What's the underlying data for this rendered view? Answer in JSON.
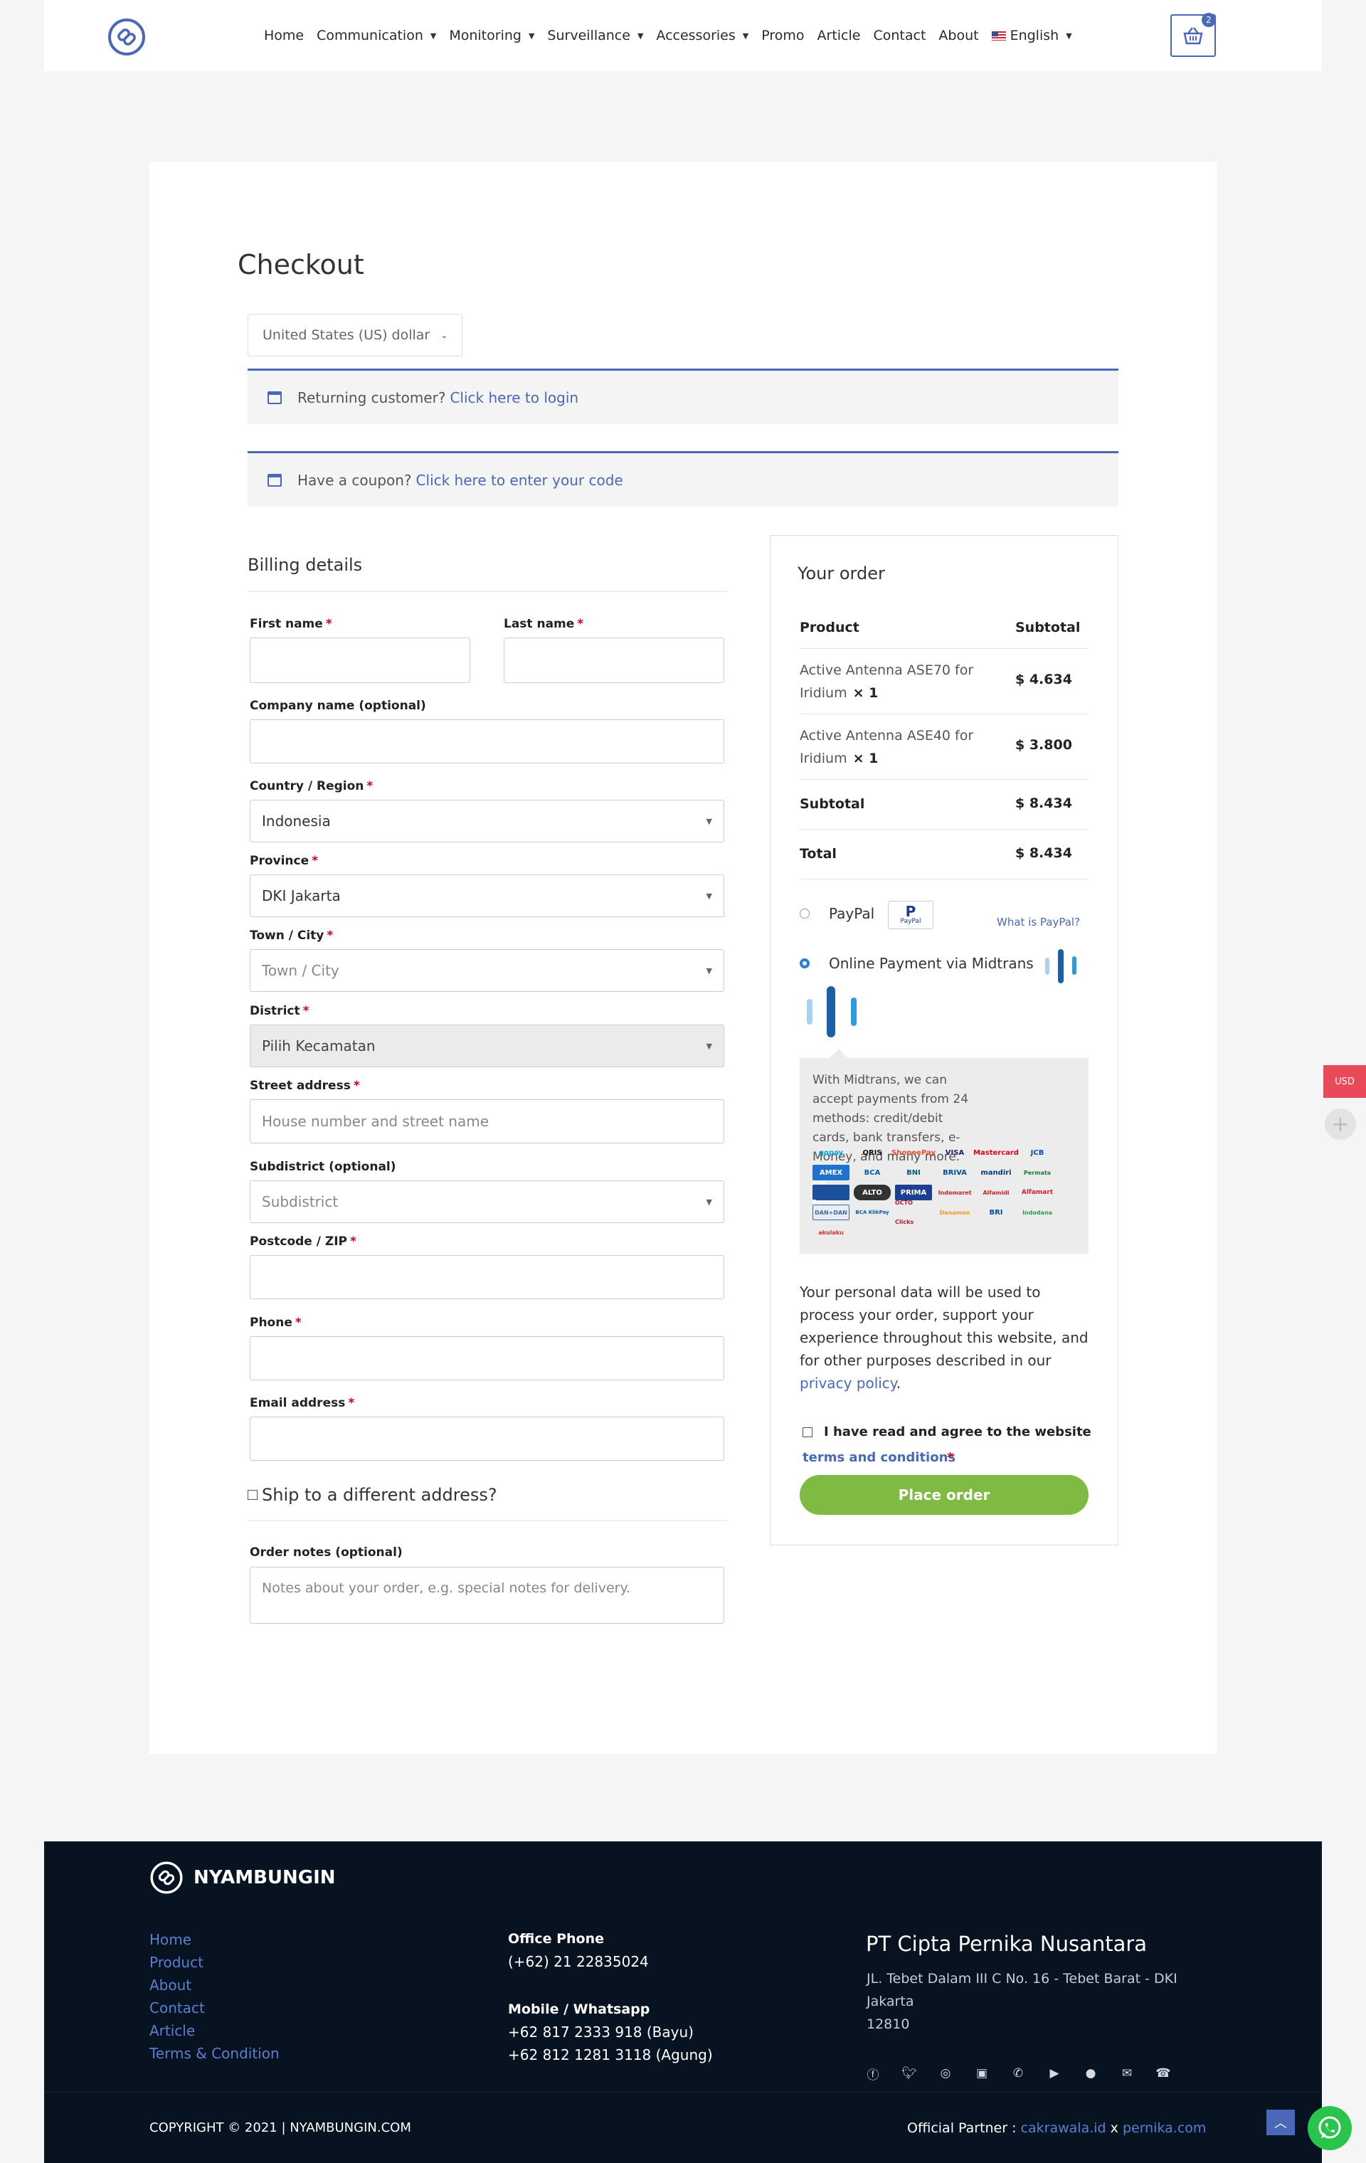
{
  "nav": {
    "items": [
      {
        "label": "Home",
        "dropdown": false
      },
      {
        "label": "Communication",
        "dropdown": true
      },
      {
        "label": "Monitoring",
        "dropdown": true
      },
      {
        "label": "Surveillance",
        "dropdown": true
      },
      {
        "label": "Accessories",
        "dropdown": true
      },
      {
        "label": "Promo",
        "dropdown": false
      },
      {
        "label": "Article",
        "dropdown": false
      },
      {
        "label": "Contact",
        "dropdown": false
      },
      {
        "label": "About",
        "dropdown": false
      }
    ],
    "language": "English",
    "cart_count": "2"
  },
  "checkout": {
    "title": "Checkout",
    "currency": "United States (US) dollar",
    "returning": {
      "text": "Returning customer?",
      "link": "Click here to login"
    },
    "coupon": {
      "text": "Have a coupon?",
      "link": "Click here to enter your code"
    }
  },
  "billing": {
    "title": "Billing details",
    "first_name": "First name",
    "last_name": "Last name",
    "company": "Company name (optional)",
    "country_label": "Country / Region",
    "country_value": "Indonesia",
    "province_label": "Province",
    "province_value": "DKI Jakarta",
    "city_label": "Town / City",
    "city_placeholder": "Town / City",
    "district_label": "District",
    "district_value": "Pilih Kecamatan",
    "street_label": "Street address",
    "street_placeholder": "House number and street name",
    "subdistrict_label": "Subdistrict (optional)",
    "subdistrict_placeholder": "Subdistrict",
    "postcode_label": "Postcode / ZIP",
    "phone_label": "Phone",
    "email_label": "Email address",
    "ship_different": "Ship to a different address?",
    "notes_label": "Order notes (optional)",
    "notes_placeholder": "Notes about your order, e.g. special notes for delivery.",
    "required_mark": "*"
  },
  "order": {
    "title": "Your order",
    "col_product": "Product",
    "col_subtotal": "Subtotal",
    "items": [
      {
        "name": "Active Antenna ASE70 for Iridium",
        "qty": "× 1",
        "price": "$ 4.634"
      },
      {
        "name": "Active Antenna ASE40 for Iridium",
        "qty": "× 1",
        "price": "$ 3.800"
      }
    ],
    "subtotal_label": "Subtotal",
    "subtotal_value": "$ 8.434",
    "total_label": "Total",
    "total_value": "$ 8.434",
    "paypal_label": "PayPal",
    "paypal_badge": "PayPal",
    "paypal_link": "What is PayPal?",
    "midtrans_label": "Online Payment via Midtrans",
    "midtrans_desc": "With Midtrans, we can accept payments from 24 methods: credit/debit cards, bank transfers, e-Money, and many more.",
    "pay_logos": [
      "gopay",
      "QRIS",
      "ShopeePay",
      "VISA",
      "Mastercard",
      "JCB",
      "AMEX",
      "BCA",
      "BNI",
      "BRIVA",
      "mandiri",
      "Permata",
      "ATM Bersama",
      "ALTO",
      "PRIMA",
      "Indomaret",
      "Alfamidi",
      "Alfamart",
      "DAN+DAN",
      "BCA KlikPay",
      "OCTO Clicks",
      "Danamon",
      "BRI",
      "Indodana",
      "akulaku"
    ],
    "privacy_text": "Your personal data will be used to process your order, support your experience throughout this website, and for other purposes described in our",
    "privacy_link": "privacy policy",
    "privacy_end": ".",
    "terms_text": "I have read and agree to the website",
    "terms_link": "terms and conditions",
    "place_order": "Place order"
  },
  "side": {
    "currency_badge": "USD"
  },
  "footer": {
    "brand": "NYAMBUNGIN",
    "links": [
      "Home",
      "Product",
      "About",
      "Contact",
      "Article",
      "Terms & Condition"
    ],
    "office_phone_label": "Office Phone",
    "office_phone": "(+62) 21 22835024",
    "mobile_label": "Mobile / Whatsapp",
    "mobile_1": "+62 817 2333 918 (Bayu)",
    "mobile_2": "+62 812 1281 3118 (Agung)",
    "company": "PT Cipta Pernika Nusantara",
    "address_1": "JL. Tebet Dalam III C No. 16 - Tebet Barat - DKI Jakarta",
    "address_2": "12810",
    "social_icons": [
      "facebook",
      "twitter",
      "instagram",
      "linkedin",
      "whatsapp",
      "youtube",
      "github",
      "email",
      "phone"
    ],
    "copyright": "COPYRIGHT © 2021 | NYAMBUNGIN.COM",
    "partner_label": "Official Partner :",
    "partner_1": "cakrawala.id",
    "partner_sep": "x",
    "partner_2": "pernika.com"
  }
}
